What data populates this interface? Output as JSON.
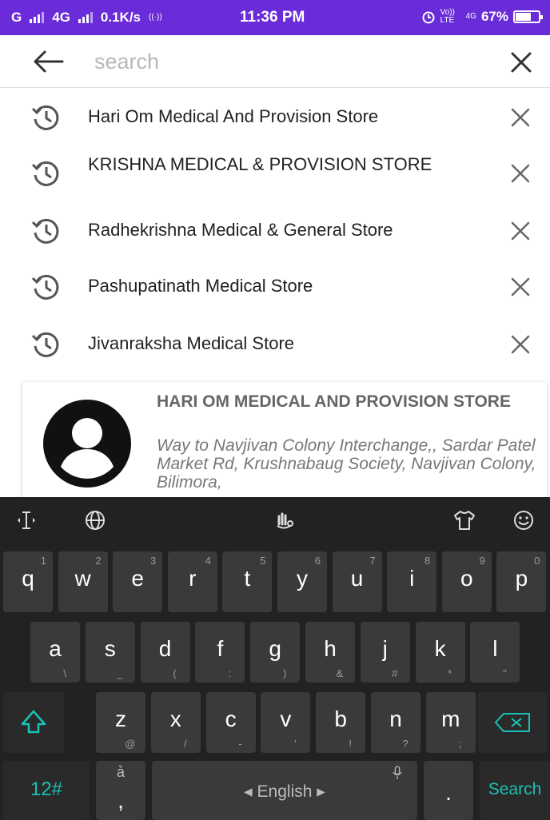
{
  "status_bar": {
    "carrier_left": "G",
    "network": "4G",
    "speed": "0.1K/s",
    "time": "11:36 PM",
    "volte": "Vo)) LTE",
    "network2": "4G",
    "battery_percent": "67%",
    "battery_level": 0.67
  },
  "search": {
    "placeholder": "search",
    "value": ""
  },
  "history": [
    {
      "label": "Hari Om Medical And Provision Store"
    },
    {
      "label": "KRISHNA MEDICAL & PROVISION STORE"
    },
    {
      "label": "Radhekrishna Medical & General Store"
    },
    {
      "label": "Pashupatinath Medical Store"
    },
    {
      "label": "Jivanraksha Medical Store"
    }
  ],
  "result": {
    "title": "HARI OM MEDICAL AND PROVISION STORE",
    "address": "Way to Navjivan Colony Interchange,, Sardar Patel Market Rd, Krushnabaug Society, Navjivan Colony, Bilimora,"
  },
  "keyboard": {
    "row1": [
      {
        "k": "q",
        "s": "1"
      },
      {
        "k": "w",
        "s": "2"
      },
      {
        "k": "e",
        "s": "3"
      },
      {
        "k": "r",
        "s": "4"
      },
      {
        "k": "t",
        "s": "5"
      },
      {
        "k": "y",
        "s": "6"
      },
      {
        "k": "u",
        "s": "7"
      },
      {
        "k": "i",
        "s": "8"
      },
      {
        "k": "o",
        "s": "9"
      },
      {
        "k": "p",
        "s": "0"
      }
    ],
    "row2": [
      {
        "k": "a",
        "s": "\\"
      },
      {
        "k": "s",
        "s": "_"
      },
      {
        "k": "d",
        "s": "("
      },
      {
        "k": "f",
        "s": ":"
      },
      {
        "k": "g",
        "s": ")"
      },
      {
        "k": "h",
        "s": "&"
      },
      {
        "k": "j",
        "s": "#"
      },
      {
        "k": "k",
        "s": "*"
      },
      {
        "k": "l",
        "s": "\""
      }
    ],
    "row3": [
      {
        "k": "z",
        "s": "@"
      },
      {
        "k": "x",
        "s": "/"
      },
      {
        "k": "c",
        "s": "-"
      },
      {
        "k": "v",
        "s": "'"
      },
      {
        "k": "b",
        "s": "!"
      },
      {
        "k": "n",
        "s": "?"
      },
      {
        "k": "m",
        "s": ";"
      }
    ],
    "symbols_label": "12#",
    "comma_key": ",",
    "space_label": "◂ English ▸",
    "period_key": ".",
    "search_label": "Search",
    "accent_color": "#19c1b6"
  }
}
